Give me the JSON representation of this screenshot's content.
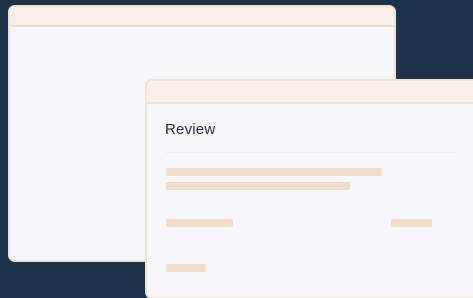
{
  "dialog": {
    "title": "Review"
  },
  "colors": {
    "background": "#1c3349",
    "window_body": "#f7f6fa",
    "window_border": "#f1e3d4",
    "titlebar": "#f8efea",
    "skeleton": "#f1dcc8",
    "title_text": "#1f2a44"
  }
}
